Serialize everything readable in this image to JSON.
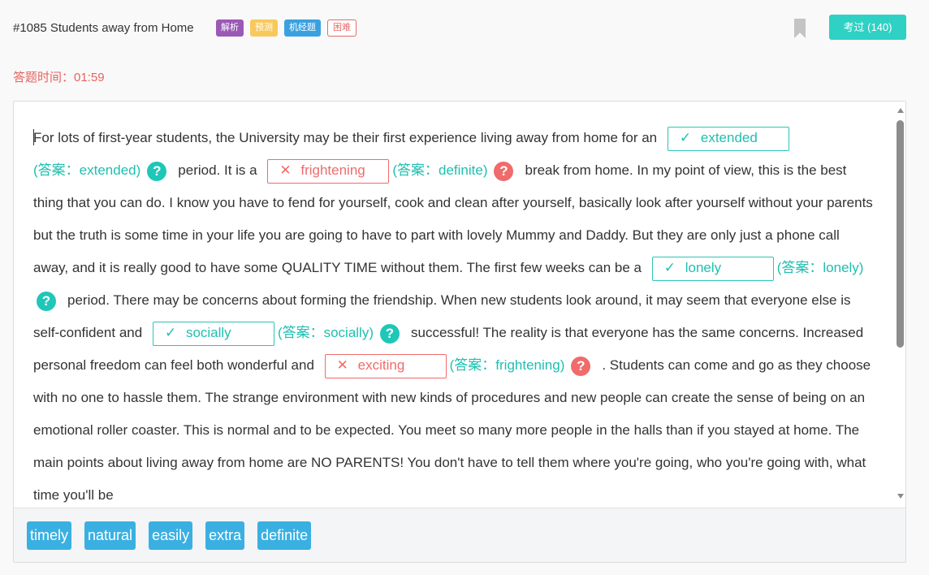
{
  "header": {
    "title": "#1085 Students away from Home",
    "tags": [
      {
        "label": "解析",
        "color": "#9b59b6"
      },
      {
        "label": "预测",
        "color": "#f7c95c"
      },
      {
        "label": "机经题",
        "color": "#3aa1e0"
      },
      {
        "label": "困难",
        "color": "#e36b6b"
      }
    ],
    "bookmark_icon": "bookmark-icon",
    "kaoguo_label": "考过 (140)"
  },
  "timer": "答题时间：01:59",
  "passage": {
    "t0": "For lots of first-year students, the University may be their first experience living away from home for an",
    "t1": "period. It is a",
    "t2": "break from home. In my point of view, this is the best thing that you can do. I know you have to fend for yourself, cook and clean after yourself, basically look after yourself without your parents but the truth is some time in your life you are going to have to part with lovely Mummy and Daddy. But they are only just a phone call away, and it is really good to have some QUALITY TIME without them. The first few weeks can be a",
    "t3": "period. There may be concerns about forming the friendship. When new students look around, it may seem that everyone else is self-confident and",
    "t4": "successful! The reality is that everyone has the same concerns. Increased personal freedom can feel both wonderful and",
    "t5": ". Students can come and go as they choose with no one to hassle them. The strange environment with new kinds of procedures and new people can create the sense of being on an emotional roller coaster. This is normal and to be expected. You meet so many more people in the halls than if you stayed at home. The main points about living away from home are NO PARENTS! You don't have to tell them where you're going, who you're going with, what time you'll be",
    "blanks": [
      {
        "mark": "✓",
        "value": "extended",
        "answer": "(答案：extended)",
        "result": "?"
      },
      {
        "mark": "✕",
        "value": "frightening",
        "answer": "(答案：definite)",
        "result": "?"
      },
      {
        "mark": "✓",
        "value": "lonely",
        "answer": "(答案：lonely)",
        "result": "?"
      },
      {
        "mark": "✓",
        "value": "socially",
        "answer": "(答案：socially)",
        "result": "?"
      },
      {
        "mark": "✕",
        "value": "exciting",
        "answer": "(答案：frightening)",
        "result": "?"
      }
    ]
  },
  "word_bank": [
    "timely",
    "natural",
    "easily",
    "extra",
    "definite"
  ],
  "colors": {
    "correct": "#1fc7b8",
    "wrong": "#f06b6b",
    "chip": "#3ab0e2",
    "primary_button": "#2ed1c4"
  }
}
